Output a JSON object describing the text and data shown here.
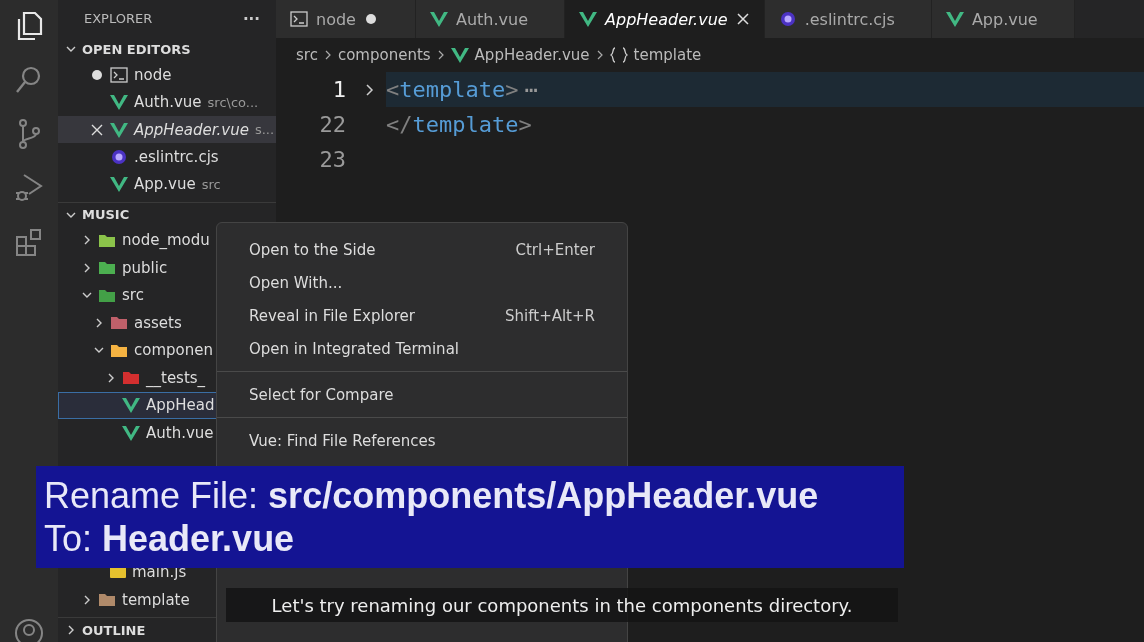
{
  "activity_bar": {
    "items": [
      {
        "kind": "files",
        "selected": true
      },
      {
        "kind": "search",
        "selected": false
      },
      {
        "kind": "source-control",
        "selected": false
      },
      {
        "kind": "run",
        "selected": false
      },
      {
        "kind": "extensions",
        "selected": false
      },
      {
        "kind": "account",
        "selected": false
      }
    ]
  },
  "sidebar": {
    "title": "EXPLORER",
    "more": "···",
    "open_editors": {
      "title": "OPEN EDITORS",
      "expanded": true,
      "items": [
        {
          "kind": "terminal",
          "label": "node",
          "dirty": true,
          "selected": false,
          "preview": false
        },
        {
          "kind": "vue",
          "label": "Auth.vue",
          "description": "src\\co...",
          "dirty": false,
          "selected": false,
          "preview": false
        },
        {
          "kind": "vue",
          "label": "AppHeader.vue",
          "description": "s...",
          "dirty": false,
          "selected": true,
          "preview": true
        },
        {
          "kind": "eslint",
          "label": ".eslintrc.cjs",
          "dirty": false,
          "selected": false,
          "preview": false
        },
        {
          "kind": "vue",
          "label": "App.vue",
          "description": "src",
          "dirty": false,
          "selected": false,
          "preview": false
        }
      ]
    },
    "project": {
      "title": "MUSIC",
      "expanded": true,
      "tree": [
        {
          "kind": "folder",
          "label": "node_modu",
          "color": "#8bc34a",
          "expanded": false,
          "selected": false
        },
        {
          "kind": "folder",
          "label": "public",
          "color": "#4caf50",
          "expanded": false,
          "selected": false
        },
        {
          "kind": "folder",
          "label": "src",
          "color": "#43a047",
          "expanded": true,
          "selected": false,
          "children": [
            {
              "kind": "folder",
              "label": "assets",
              "color": "#c0606a",
              "expanded": false,
              "selected": false
            },
            {
              "kind": "folder",
              "label": "componen",
              "color": "#f5b342",
              "expanded": true,
              "selected": false,
              "children": [
                {
                  "kind": "folder",
                  "label": "__tests_",
                  "color": "#d32f2f",
                  "expanded": false,
                  "selected": false
                },
                {
                  "kind": "vue",
                  "label": "AppHead",
                  "selected": true
                },
                {
                  "kind": "vue",
                  "label": "Auth.vue",
                  "selected": false
                }
              ]
            },
            {
              "kind": "js",
              "label": "main.js",
              "selected": false
            }
          ]
        },
        {
          "kind": "folder",
          "label": "template",
          "color": "#b08a6a",
          "expanded": false,
          "selected": false
        }
      ]
    },
    "outline": {
      "title": "OUTLINE",
      "expanded": false
    }
  },
  "tabs": [
    {
      "kind": "terminal",
      "label": "node",
      "dirty": true,
      "selected": false,
      "preview": false
    },
    {
      "kind": "vue",
      "label": "Auth.vue",
      "dirty": false,
      "selected": false,
      "preview": false
    },
    {
      "kind": "vue",
      "label": "AppHeader.vue",
      "dirty": false,
      "selected": true,
      "preview": true
    },
    {
      "kind": "eslint",
      "label": ".eslintrc.cjs",
      "dirty": false,
      "selected": false,
      "preview": false
    },
    {
      "kind": "vue",
      "label": "App.vue",
      "dirty": false,
      "selected": false,
      "preview": false
    }
  ],
  "breadcrumbs": [
    {
      "kind": "text",
      "label": "src"
    },
    {
      "kind": "text",
      "label": "components"
    },
    {
      "kind": "vue",
      "label": "AppHeader.vue"
    },
    {
      "kind": "braces",
      "label": "template"
    }
  ],
  "editor": {
    "lines": [
      {
        "number": "1",
        "folded": true,
        "active": true,
        "tokens": [
          {
            "kind": "punct",
            "text": "<"
          },
          {
            "kind": "tag",
            "text": "template"
          },
          {
            "kind": "punct",
            "text": ">"
          }
        ],
        "ellipsis": "⋯"
      },
      {
        "number": "22",
        "folded": false,
        "active": false,
        "tokens": [
          {
            "kind": "punct",
            "text": "</"
          },
          {
            "kind": "tag",
            "text": "template"
          },
          {
            "kind": "punct",
            "text": ">"
          }
        ]
      },
      {
        "number": "23",
        "folded": false,
        "active": false
      }
    ]
  },
  "context_menu": {
    "groups": [
      [
        {
          "label": "Open to the Side",
          "shortcut": "Ctrl+Enter"
        },
        {
          "label": "Open With..."
        },
        {
          "label": "Reveal in File Explorer",
          "shortcut": "Shift+Alt+R"
        },
        {
          "label": "Open in Integrated Terminal"
        }
      ],
      [
        {
          "label": "Select for Compare"
        }
      ],
      [
        {
          "label": "Vue: Find File References"
        }
      ]
    ]
  },
  "banner": {
    "lines": [
      "Rename File: **src/components/AppHeader.vue**",
      "To: **Header.vue**"
    ]
  },
  "subtitle": "Let's try renaming our components in the components directory."
}
